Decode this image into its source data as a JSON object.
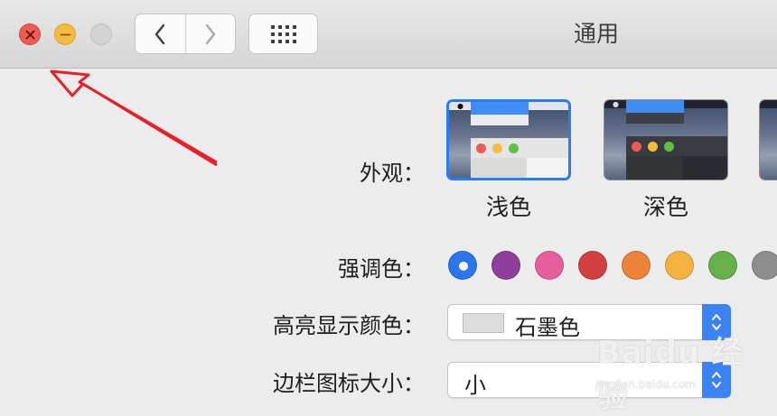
{
  "window": {
    "title": "通用",
    "controls": {
      "close": "close-icon",
      "minimize": "minimize-icon",
      "zoom": "zoom-icon"
    },
    "nav": {
      "back": "chevron-left-icon",
      "forward": "chevron-right-icon",
      "show_all": "grid-icon"
    }
  },
  "appearance": {
    "label": "外观：",
    "options": [
      {
        "label": "浅色",
        "selected": true
      },
      {
        "label": "深色",
        "selected": false
      }
    ]
  },
  "accent_color": {
    "label": "强调色：",
    "colors": [
      "#2b76ed",
      "#8e3f9b",
      "#e65e9e",
      "#d1403f",
      "#ec843b",
      "#f4b33f",
      "#66b14c",
      "#8e8e8e"
    ],
    "selected_index": 0
  },
  "highlight_color": {
    "label": "高亮显示颜色：",
    "value": "石墨色",
    "swatch": "#dcdcdc"
  },
  "sidebar_icon_size": {
    "label": "边栏图标大小：",
    "value": "小"
  },
  "watermark": {
    "brand": "Baidu 经验",
    "url": "jingyan.baidu.com"
  },
  "colors": {
    "accent": "#2d7bf0",
    "annotation": "#e8202a"
  }
}
